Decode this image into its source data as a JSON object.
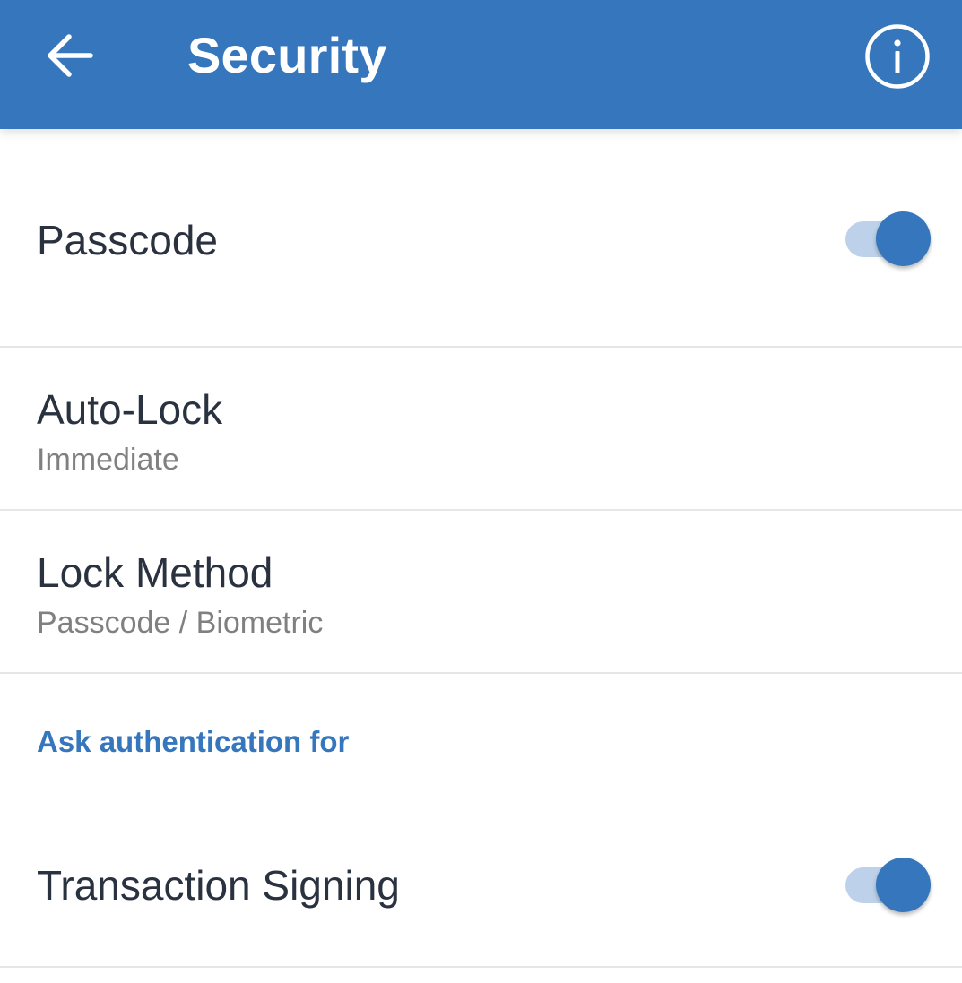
{
  "header": {
    "title": "Security",
    "back_icon": "arrow-left-icon",
    "info_icon": "info-circle-icon",
    "background_color": "#3576bc"
  },
  "settings": {
    "passcode": {
      "label": "Passcode",
      "enabled": true
    },
    "auto_lock": {
      "label": "Auto-Lock",
      "value": "Immediate"
    },
    "lock_method": {
      "label": "Lock Method",
      "value": "Passcode / Biometric"
    },
    "section_title": "Ask authentication for",
    "transaction_signing": {
      "label": "Transaction Signing",
      "enabled": true
    }
  },
  "colors": {
    "accent": "#3576bc",
    "toggle_track": "#bdd2ea",
    "text_primary": "#2a3240",
    "text_secondary": "#808080",
    "divider": "#e6e6e6"
  }
}
